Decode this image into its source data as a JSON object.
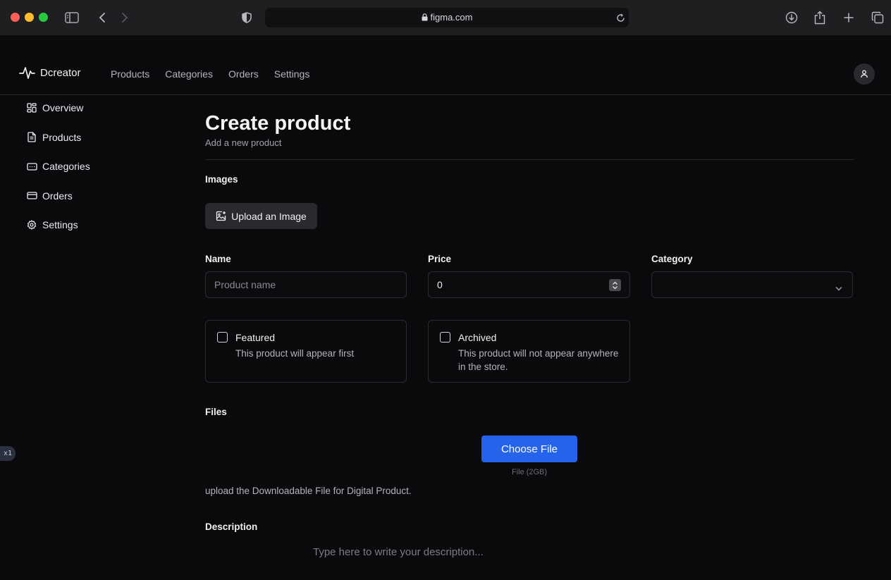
{
  "browser": {
    "url": "figma.com",
    "icons": [
      "sidebar-toggle-icon",
      "back-icon",
      "forward-icon",
      "shield-icon",
      "lock-icon",
      "reload-icon",
      "download-icon",
      "share-icon",
      "new-tab-icon",
      "tabs-icon"
    ]
  },
  "header": {
    "brand": "Dcreator",
    "nav": [
      "Products",
      "Categories",
      "Orders",
      "Settings"
    ]
  },
  "sidebar": {
    "items": [
      {
        "label": "Overview",
        "icon": "overview-icon"
      },
      {
        "label": "Products",
        "icon": "document-icon"
      },
      {
        "label": "Categories",
        "icon": "categories-icon"
      },
      {
        "label": "Orders",
        "icon": "card-icon"
      },
      {
        "label": "Settings",
        "icon": "gear-icon"
      }
    ]
  },
  "main": {
    "title": "Create product",
    "subtitle": "Add a new product",
    "images_label": "Images",
    "upload_label": "Upload an Image",
    "name_label": "Name",
    "name_placeholder": "Product name",
    "price_label": "Price",
    "price_value": "0",
    "category_label": "Category",
    "category_value": "",
    "featured": {
      "title": "Featured",
      "desc": "This product will appear first",
      "checked": false
    },
    "archived": {
      "title": "Archived",
      "desc": "This product will not appear anywhere in the store.",
      "checked": false
    },
    "files_label": "Files",
    "choose_file_label": "Choose File",
    "file_hint": "File (2GB)",
    "files_help": "upload the Downloadable File for Digital Product.",
    "description_label": "Description",
    "description_placeholder": "Type here to write your description..."
  },
  "badge": "x1",
  "colors": {
    "background": "#0a0a0c",
    "accent": "#2563eb",
    "border": "#2c2c30"
  }
}
